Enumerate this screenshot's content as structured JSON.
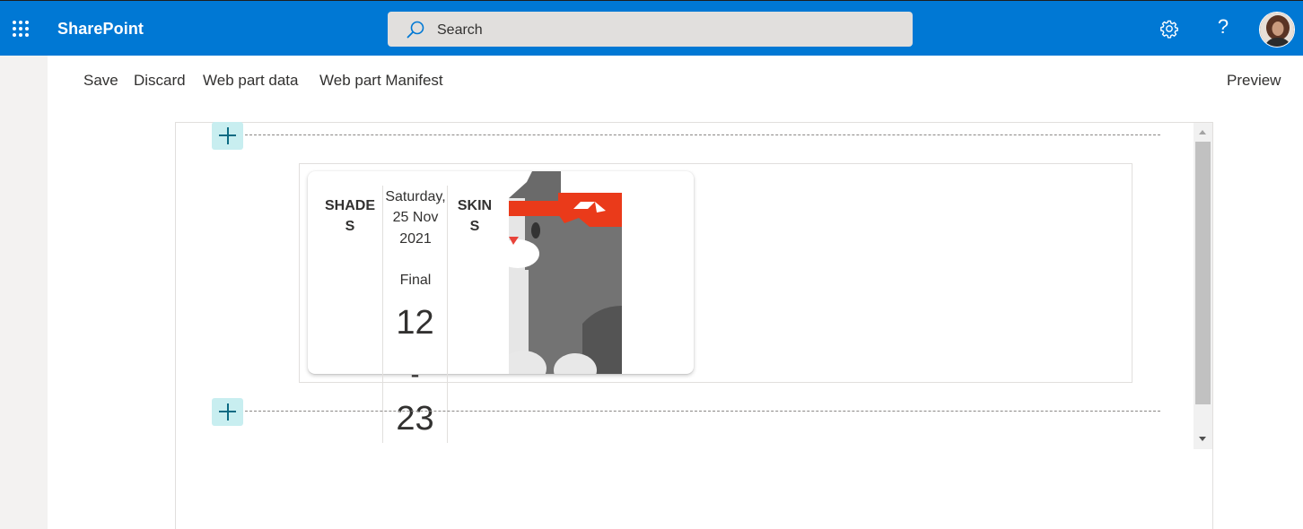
{
  "suitebar": {
    "app_title": "SharePoint",
    "search_placeholder": "Search",
    "icons": [
      "waffle-icon",
      "search-icon",
      "gear-icon",
      "help-icon"
    ],
    "help_glyph": "?",
    "brand_color": "#0078d4"
  },
  "commandbar": {
    "save": "Save",
    "discard": "Discard",
    "webpart_data": "Web part data",
    "webpart_manifest": "Web part Manifest",
    "preview": "Preview"
  },
  "canvas": {
    "add_section_icon": "plus-icon"
  },
  "match_card": {
    "home_team": "SHADES",
    "away_team": "SKINS",
    "date": "Saturday, 25 Nov 2021",
    "status": "Final",
    "home_score": "12",
    "separator": "-",
    "away_score": "23"
  }
}
